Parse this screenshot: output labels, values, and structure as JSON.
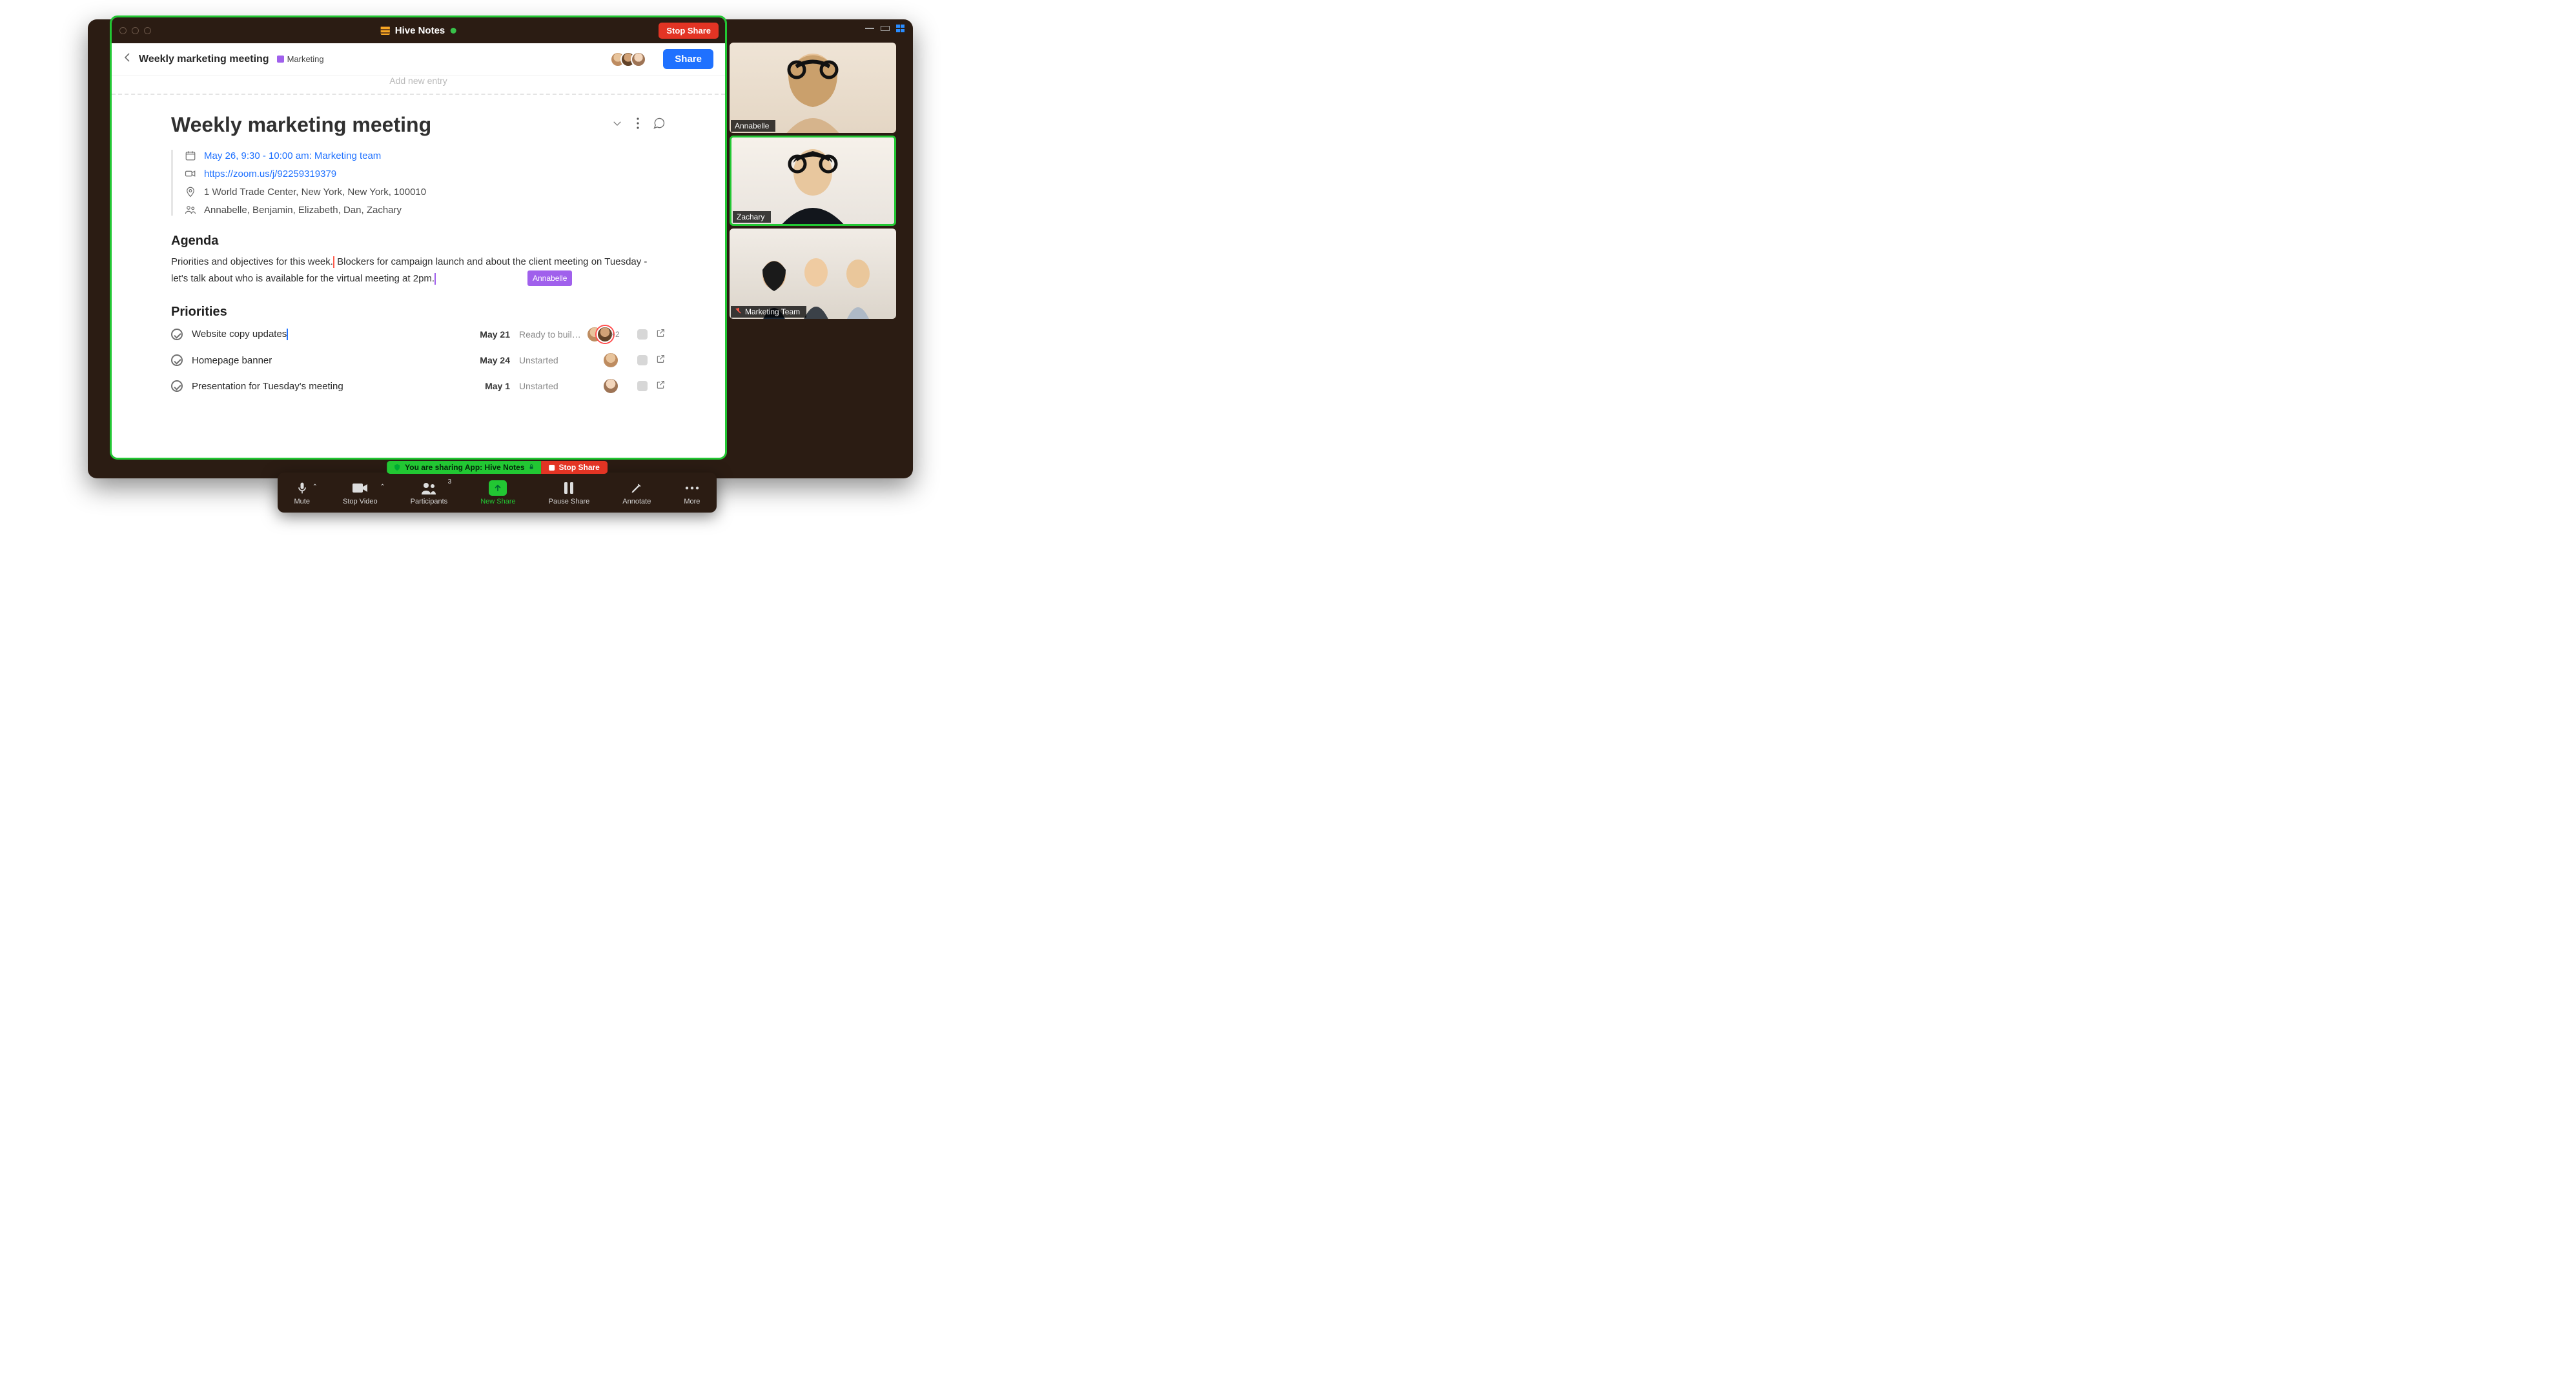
{
  "zoom": {
    "sharing_banner_left": "You are sharing App: Hive Notes",
    "sharing_banner_right": "Stop Share",
    "toolbar": {
      "mute": "Mute",
      "stop_video": "Stop Video",
      "participants": "Participants",
      "participants_count": "3",
      "new_share": "New Share",
      "pause_share": "Pause Share",
      "annotate": "Annotate",
      "more": "More"
    },
    "video_tiles": [
      {
        "name": "Annabelle",
        "speaking": false,
        "muted": false
      },
      {
        "name": "Zachary",
        "speaking": true,
        "muted": false
      },
      {
        "name": "Marketing Team",
        "speaking": false,
        "muted": true
      }
    ]
  },
  "hive": {
    "app_title": "Hive Notes",
    "stop_share": "Stop Share",
    "breadcrumb_title": "Weekly marketing meeting",
    "tag_label": "Marketing",
    "tag_color": "#a060ec",
    "share_button": "Share",
    "add_entry_placeholder": "Add new entry",
    "doc_title": "Weekly marketing meeting",
    "meta": {
      "schedule": "May 26, 9:30 - 10:00 am: Marketing team",
      "link": "https://zoom.us/j/92259319379",
      "location": "1 World Trade Center, New York, New York, 100010",
      "attendees": "Annabelle, Benjamin, Elizabeth, Dan, Zachary"
    },
    "agenda": {
      "heading": "Agenda",
      "text_a": "Priorities and objectives for this week.",
      "text_b": "Blockers for campaign launch and about the client meeting on Tuesday - let's talk about who is available for the virtual meeting at 2pm.",
      "cursor_user": "Annabelle"
    },
    "priorities": {
      "heading": "Priorities",
      "tasks": [
        {
          "name": "Website copy updates",
          "due": "May 21",
          "status": "Ready to buil…",
          "extra": "+2",
          "assignees": 2
        },
        {
          "name": "Homepage banner",
          "due": "May 24",
          "status": "Unstarted",
          "extra": "",
          "assignees": 1
        },
        {
          "name": "Presentation for Tuesday's meeting",
          "due": "May 1",
          "status": "Unstarted",
          "extra": "",
          "assignees": 1
        }
      ]
    }
  }
}
